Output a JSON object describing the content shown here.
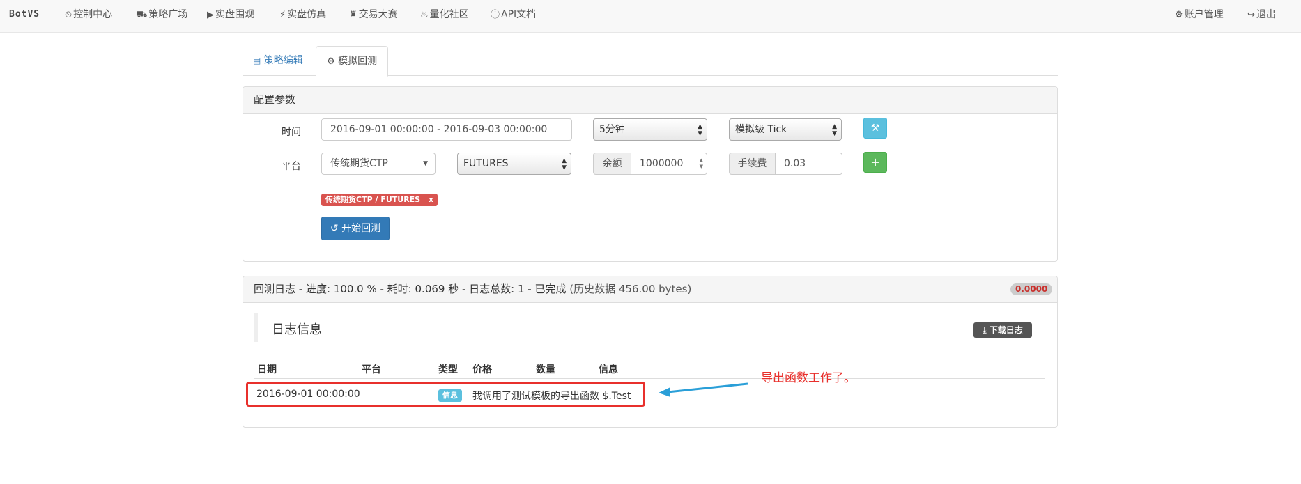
{
  "nav": {
    "brand": "BotVS",
    "items": [
      {
        "icon": "clock-icon",
        "glyph": "⏲",
        "label": "控制中心"
      },
      {
        "icon": "cart-icon",
        "glyph": "⛟",
        "label": "策略广场"
      },
      {
        "icon": "play-circle-icon",
        "glyph": "▶",
        "label": "实盘围观"
      },
      {
        "icon": "bolt-icon",
        "glyph": "⚡",
        "label": "实盘仿真"
      },
      {
        "icon": "tower-icon",
        "glyph": "♜",
        "label": "交易大赛"
      },
      {
        "icon": "fire-icon",
        "glyph": "♨",
        "label": "量化社区"
      },
      {
        "icon": "info-icon",
        "glyph": "ⓘ",
        "label": "API文档"
      }
    ],
    "right": [
      {
        "icon": "gear-icon",
        "glyph": "⚙",
        "label": "账户管理"
      },
      {
        "icon": "logout-icon",
        "glyph": "↪",
        "label": "退出"
      }
    ]
  },
  "tabs": {
    "edit": "策略编辑",
    "backtest": "模拟回测"
  },
  "config": {
    "title": "配置参数",
    "time_label": "时间",
    "time_range": "2016-09-01 00:00:00 - 2016-09-03 00:00:00",
    "period": "5分钟",
    "tick_mode": "模拟级 Tick",
    "platform_label": "平台",
    "platform": "传统期货CTP",
    "contract": "FUTURES",
    "balance_label": "余额",
    "balance": "1000000",
    "fee_label": "手续费",
    "fee": "0.03",
    "selected_tag": "传统期货CTP / FUTURES",
    "tag_remove": "x",
    "start_button": "开始回测"
  },
  "log_panel": {
    "title": "回测日志 - 进度: 100.0 % - 耗时: 0.069 秒 - 日志总数: 1 - 已完成",
    "history": "(历史数据 456.00 bytes)",
    "badge": "0.0000",
    "section_title": "日志信息",
    "download_button": "下载日志",
    "columns": [
      "日期",
      "平台",
      "类型",
      "价格",
      "数量",
      "信息"
    ],
    "rows": [
      {
        "date": "2016-09-01 00:00:00",
        "platform": "",
        "type": "信息",
        "price": "我调用了测试模板的导出函数 $.Test",
        "amount": "",
        "info": ""
      }
    ]
  },
  "annotation": {
    "text": "导出函数工作了。",
    "color": "#e8302c",
    "arrow_color": "#2a9fd8"
  }
}
